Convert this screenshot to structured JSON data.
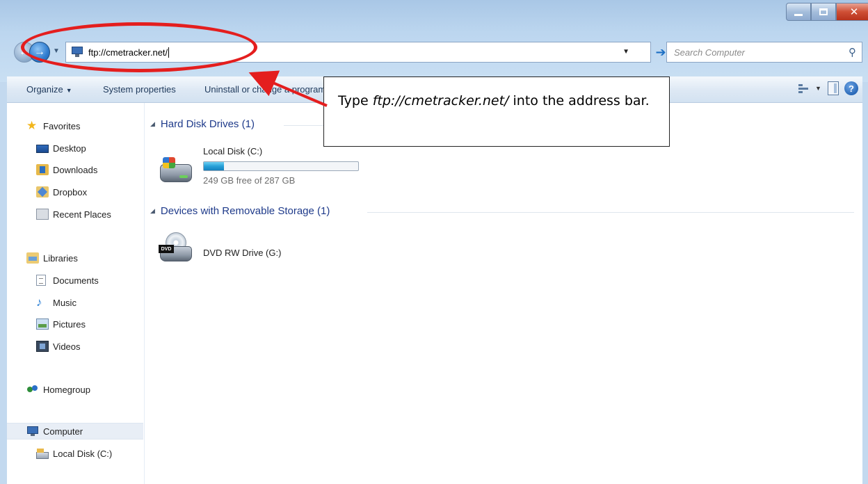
{
  "address_bar": {
    "url": "ftp://cmetracker.net/"
  },
  "search": {
    "placeholder": "Search Computer"
  },
  "toolbar": {
    "organize": "Organize",
    "system_properties": "System properties",
    "uninstall": "Uninstall or change a program"
  },
  "callout": {
    "prefix": "Type ",
    "url": "ftp://cmetracker.net/",
    "suffix": " into the address bar."
  },
  "sidebar": {
    "favorites": {
      "label": "Favorites",
      "items": [
        "Desktop",
        "Downloads",
        "Dropbox",
        "Recent Places"
      ]
    },
    "libraries": {
      "label": "Libraries",
      "items": [
        "Documents",
        "Music",
        "Pictures",
        "Videos"
      ]
    },
    "homegroup": "Homegroup",
    "computer": {
      "label": "Computer",
      "items": [
        "Local Disk (C:)"
      ]
    }
  },
  "main": {
    "hard_disk_group": "Hard Disk Drives (1)",
    "removable_group": "Devices with Removable Storage (1)",
    "local_disk": {
      "name": "Local Disk (C:)",
      "free_text": "249 GB free of 287 GB",
      "used_fraction": 0.132
    },
    "dvd": {
      "name": "DVD RW Drive (G:)",
      "badge": "DVD"
    }
  },
  "colors": {
    "annotation_red": "#e41e1e",
    "group_header": "#1e3a8a",
    "space_fill": "#26a0d8"
  },
  "icons": {
    "back": "back-arrow-icon",
    "forward": "forward-arrow-icon",
    "go": "go-arrow-icon",
    "search": "magnifier-icon",
    "help": "help-icon"
  }
}
